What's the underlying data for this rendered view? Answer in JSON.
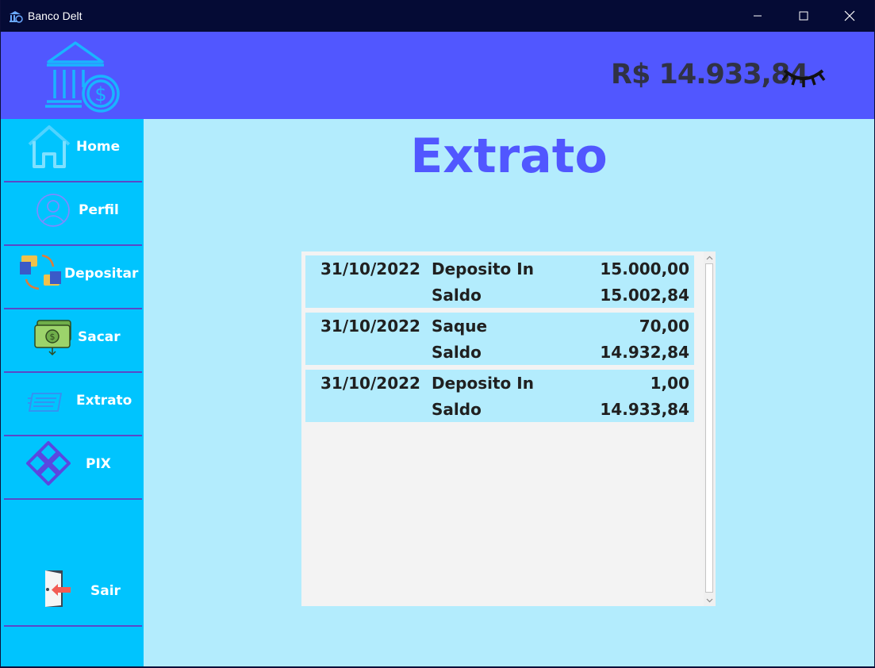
{
  "window": {
    "title": "Banco Delt",
    "controls": [
      "minimize-icon",
      "maximize-icon",
      "close-icon"
    ]
  },
  "header": {
    "balance": "R$ 14.933,84",
    "logo_icon": "bank-icon",
    "toggle_icon": "eye-closed-icon"
  },
  "sidebar": {
    "items": [
      {
        "label": "Home",
        "icon": "home-icon"
      },
      {
        "label": "Perfil",
        "icon": "user-icon"
      },
      {
        "label": "Depositar",
        "icon": "deposit-icon"
      },
      {
        "label": "Sacar",
        "icon": "cash-icon"
      },
      {
        "label": "Extrato",
        "icon": "statement-icon"
      },
      {
        "label": "PIX",
        "icon": "pix-icon"
      },
      {
        "label": "Sair",
        "icon": "exit-door-icon"
      }
    ]
  },
  "main": {
    "title": "Extrato",
    "entries": [
      {
        "date": "31/10/2022",
        "description": "Deposito In",
        "amount": "15.000,00",
        "balance_label": "Saldo",
        "balance": "15.002,84"
      },
      {
        "date": "31/10/2022",
        "description": "Saque",
        "amount": "70,00",
        "balance_label": "Saldo",
        "balance": "14.932,84"
      },
      {
        "date": "31/10/2022",
        "description": "Deposito In",
        "amount": "1,00",
        "balance_label": "Saldo",
        "balance": "14.933,84"
      }
    ]
  },
  "colors": {
    "header": "#5157ff",
    "sidebar": "#00c4fe",
    "content": "#b3ecfd",
    "titlebar": "#050b35",
    "accent": "#5157ff"
  }
}
